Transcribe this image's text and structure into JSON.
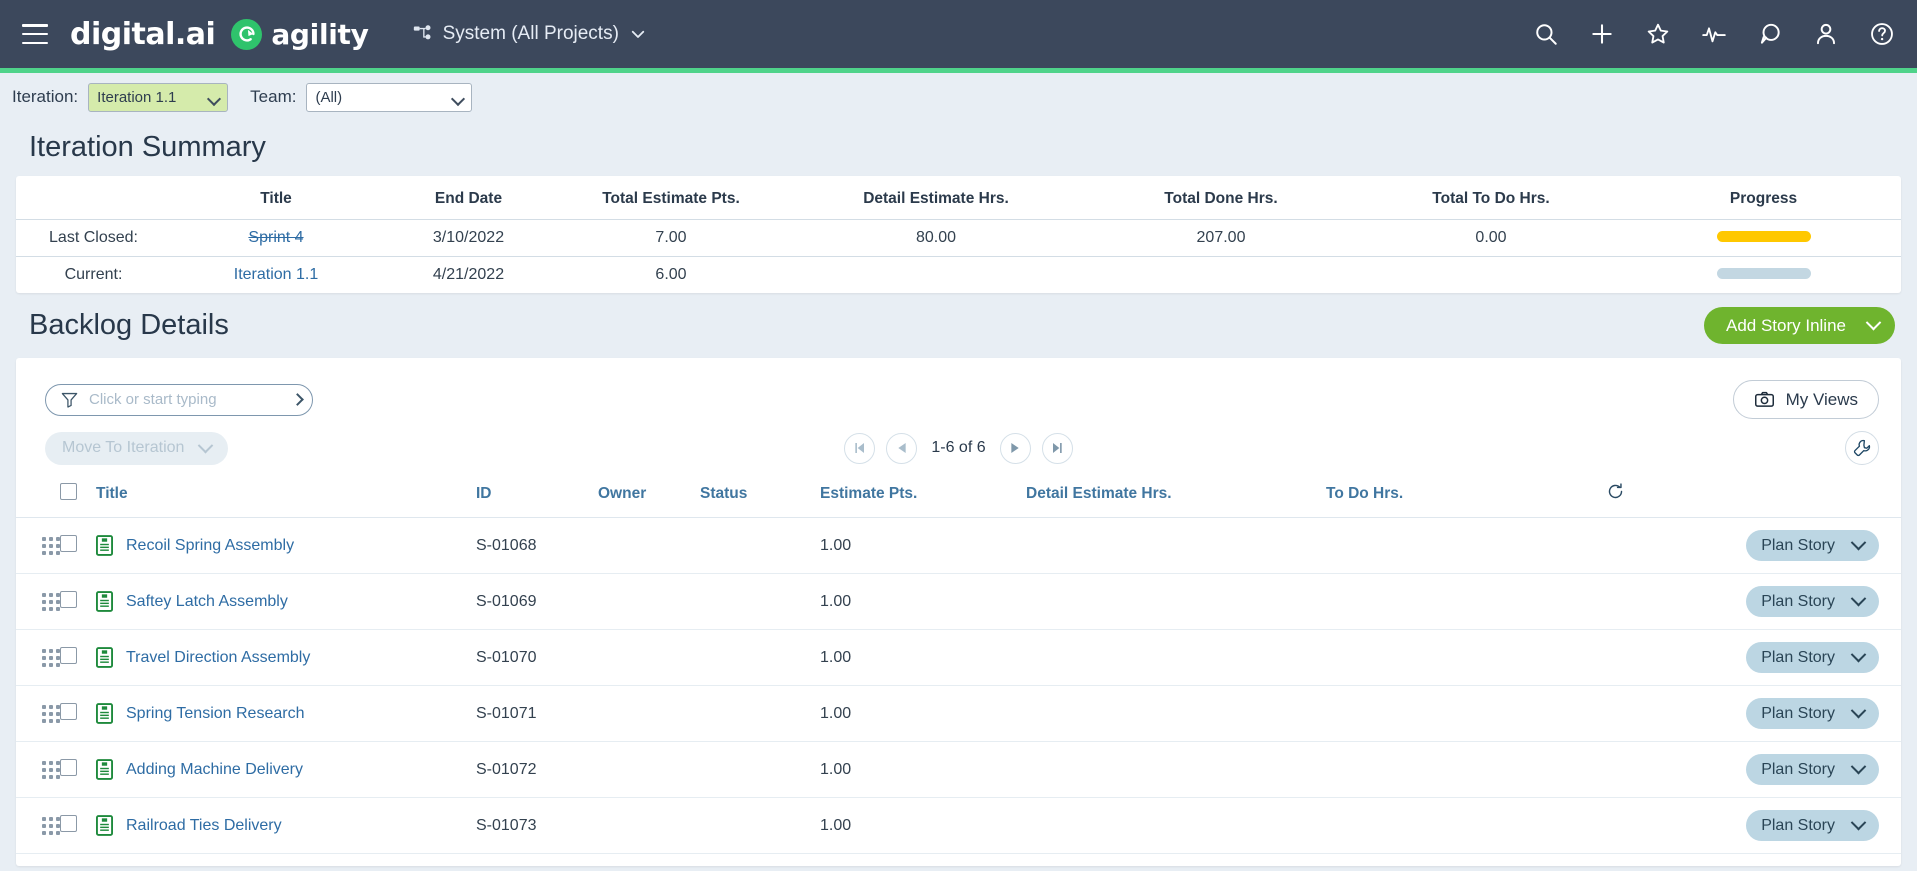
{
  "header": {
    "menu_icon": "hamburger-icon",
    "brand_digital": "digital.ai",
    "brand_agility": "agility",
    "project_selector": "System (All Projects)",
    "project_icon": "project-tree-icon",
    "icons": [
      {
        "name": "search-icon",
        "label": "Search"
      },
      {
        "name": "plus-icon",
        "label": "Add"
      },
      {
        "name": "star-icon",
        "label": "Favorites"
      },
      {
        "name": "activity-icon",
        "label": "Activity"
      },
      {
        "name": "chat-icon",
        "label": "Conversations"
      },
      {
        "name": "user-icon",
        "label": "Account"
      },
      {
        "name": "help-icon",
        "label": "Help"
      }
    ],
    "accent_bar_color": "#4fd38a",
    "background_color": "#3c485c"
  },
  "filter_bar": {
    "iteration_label": "Iteration:",
    "iteration_value": "Iteration 1.1",
    "team_label": "Team:",
    "team_value": "(All)",
    "iteration_select_bg": "#d5ebab"
  },
  "iteration_summary": {
    "title": "Iteration Summary",
    "columns": [
      "",
      "Title",
      "End Date",
      "Total Estimate Pts.",
      "Detail Estimate Hrs.",
      "Total Done Hrs.",
      "Total To Do Hrs.",
      "Progress"
    ],
    "rows": [
      {
        "label": "Last Closed:",
        "title": "Sprint 4",
        "title_strike": true,
        "end_date": "3/10/2022",
        "total_estimate_pts": "7.00",
        "detail_estimate_hrs": "80.00",
        "total_done_hrs": "207.00",
        "total_todo_hrs": "0.00",
        "progress_color": "#ffc800",
        "progress_pct": 100
      },
      {
        "label": "Current:",
        "title": "Iteration 1.1",
        "title_strike": false,
        "end_date": "4/21/2022",
        "total_estimate_pts": "6.00",
        "detail_estimate_hrs": "",
        "total_done_hrs": "",
        "total_todo_hrs": "",
        "progress_color": "#c3d7e2",
        "progress_pct": 100
      }
    ]
  },
  "backlog": {
    "title": "Backlog Details",
    "add_story_label": "Add Story Inline",
    "add_story_color": "#6fb42e",
    "filter_placeholder": "Click or start typing",
    "filter_value": "",
    "filter_icon": "funnel-icon",
    "my_views_label": "My Views",
    "my_views_icon": "camera-icon",
    "move_to_iteration_label": "Move To Iteration",
    "pager": {
      "first_icon": "page-first-icon",
      "prev_icon": "page-prev-icon",
      "range_label": "1-6 of 6",
      "next_icon": "page-next-icon",
      "last_icon": "page-last-icon"
    },
    "wrench_icon": "wrench-icon",
    "refresh_icon": "refresh-icon",
    "columns": {
      "title": "Title",
      "id": "ID",
      "owner": "Owner",
      "status": "Status",
      "estimate_pts": "Estimate Pts.",
      "detail_estimate_hrs": "Detail Estimate Hrs.",
      "todo_hrs": "To Do Hrs."
    },
    "row_action_label": "Plan Story",
    "rows": [
      {
        "title": "Recoil Spring Assembly",
        "id": "S-01068",
        "owner": "",
        "status": "",
        "estimate_pts": "1.00",
        "detail_estimate_hrs": "",
        "todo_hrs": "",
        "action": "Plan Story"
      },
      {
        "title": "Saftey Latch Assembly",
        "id": "S-01069",
        "owner": "",
        "status": "",
        "estimate_pts": "1.00",
        "detail_estimate_hrs": "",
        "todo_hrs": "",
        "action": "Plan Story"
      },
      {
        "title": "Travel Direction Assembly",
        "id": "S-01070",
        "owner": "",
        "status": "",
        "estimate_pts": "1.00",
        "detail_estimate_hrs": "",
        "todo_hrs": "",
        "action": "Plan Story"
      },
      {
        "title": "Spring Tension Research",
        "id": "S-01071",
        "owner": "",
        "status": "",
        "estimate_pts": "1.00",
        "detail_estimate_hrs": "",
        "todo_hrs": "",
        "action": "Plan Story"
      },
      {
        "title": "Adding Machine Delivery",
        "id": "S-01072",
        "owner": "",
        "status": "",
        "estimate_pts": "1.00",
        "detail_estimate_hrs": "",
        "todo_hrs": "",
        "action": "Plan Story"
      },
      {
        "title": "Railroad Ties Delivery",
        "id": "S-01073",
        "owner": "",
        "status": "",
        "estimate_pts": "1.00",
        "detail_estimate_hrs": "",
        "todo_hrs": "",
        "action": "Plan Story"
      }
    ]
  }
}
